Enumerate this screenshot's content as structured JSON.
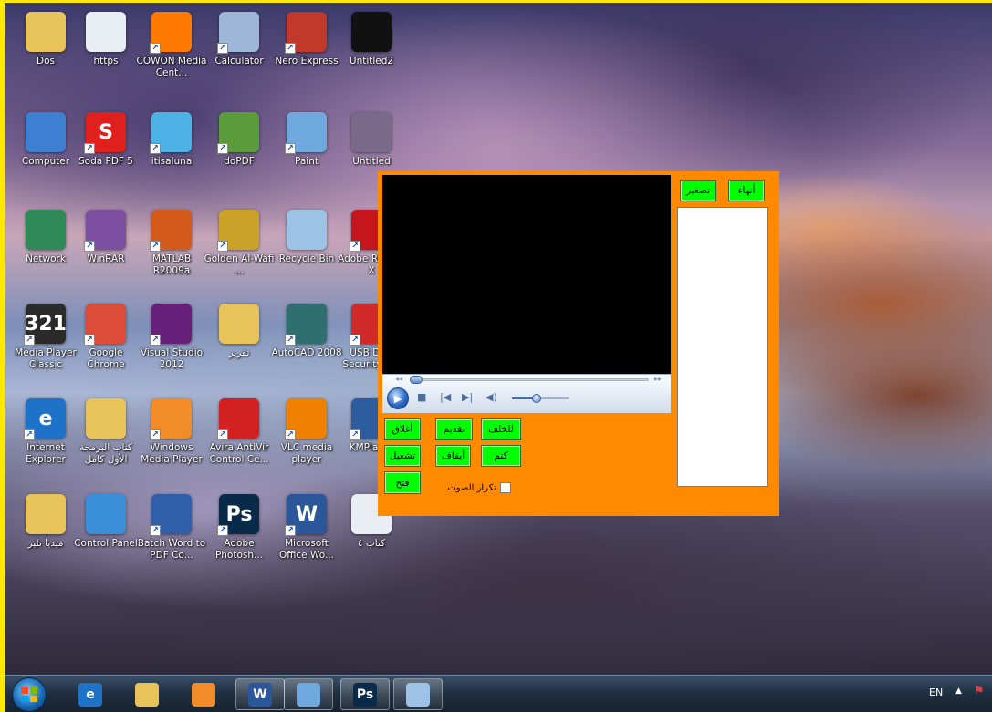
{
  "desktop_icons": [
    {
      "label": "Dos",
      "icon": "folder-user-icon",
      "color": "#e8c35a",
      "glyph": ""
    },
    {
      "label": "https",
      "icon": "document-icon",
      "color": "#e9eef5",
      "glyph": ""
    },
    {
      "label": "COWON Media Cent...",
      "icon": "cowon-icon",
      "color": "#ff7a00",
      "glyph": ""
    },
    {
      "label": "Calculator",
      "icon": "calculator-icon",
      "color": "#9fb7d6",
      "glyph": ""
    },
    {
      "label": "Nero Express",
      "icon": "nero-icon",
      "color": "#c0392b",
      "glyph": ""
    },
    {
      "label": "Untitled2",
      "icon": "image-icon",
      "color": "#111111",
      "glyph": ""
    },
    {
      "label": "Computer",
      "icon": "computer-icon",
      "color": "#3d7fd1",
      "glyph": ""
    },
    {
      "label": "Soda PDF 5",
      "icon": "soda-pdf-icon",
      "color": "#e0201c",
      "glyph": "S"
    },
    {
      "label": "itisaluna",
      "icon": "itisaluna-icon",
      "color": "#4db3e6",
      "glyph": ""
    },
    {
      "label": "doPDF",
      "icon": "dopdf-icon",
      "color": "#5a9b3c",
      "glyph": ""
    },
    {
      "label": "Paint",
      "icon": "paint-icon",
      "color": "#6fa8dc",
      "glyph": ""
    },
    {
      "label": "Untitled",
      "icon": "image-icon",
      "color": "#7a6a8a",
      "glyph": ""
    },
    {
      "label": "Network",
      "icon": "network-icon",
      "color": "#2e8b57",
      "glyph": ""
    },
    {
      "label": "WinRAR",
      "icon": "winrar-icon",
      "color": "#7b4ea0",
      "glyph": ""
    },
    {
      "label": "MATLAB R2009a",
      "icon": "matlab-icon",
      "color": "#d45a1a",
      "glyph": ""
    },
    {
      "label": "Golden Al-Wafi ...",
      "icon": "golden-icon",
      "color": "#c9a227",
      "glyph": ""
    },
    {
      "label": "Recycle Bin",
      "icon": "recycle-bin-icon",
      "color": "#9cc3e6",
      "glyph": ""
    },
    {
      "label": "Adobe Reader X",
      "icon": "adobe-reader-icon",
      "color": "#c4161c",
      "glyph": ""
    },
    {
      "label": "Media Player Classic",
      "icon": "media-player-classic-icon",
      "color": "#2b2b2b",
      "glyph": "321"
    },
    {
      "label": "Google Chrome",
      "icon": "chrome-icon",
      "color": "#dd4b39",
      "glyph": ""
    },
    {
      "label": "Visual Studio 2012",
      "icon": "visual-studio-icon",
      "color": "#68217a",
      "glyph": ""
    },
    {
      "label": "تقرير",
      "icon": "folder-icon",
      "color": "#e8c35a",
      "glyph": ""
    },
    {
      "label": "AutoCAD 2008",
      "icon": "autocad-icon",
      "color": "#2f6f6f",
      "glyph": ""
    },
    {
      "label": "USB Disk Security 5.2",
      "icon": "usb-security-icon",
      "color": "#d12a2a",
      "glyph": ""
    },
    {
      "label": "Internet Explorer",
      "icon": "internet-explorer-icon",
      "color": "#1e73c8",
      "glyph": "e"
    },
    {
      "label": "كتاب البرمجة الأول كامل",
      "icon": "folder-icon",
      "color": "#e8c35a",
      "glyph": ""
    },
    {
      "label": "Windows Media Player",
      "icon": "windows-media-player-icon",
      "color": "#f28c28",
      "glyph": ""
    },
    {
      "label": "Avira AntiVir Control Ce...",
      "icon": "avira-icon",
      "color": "#d32020",
      "glyph": ""
    },
    {
      "label": "VLC media player",
      "icon": "vlc-icon",
      "color": "#f08000",
      "glyph": ""
    },
    {
      "label": "KMPlayer",
      "icon": "kmplayer-icon",
      "color": "#2d5d9f",
      "glyph": ""
    },
    {
      "label": "ميديا بلير",
      "icon": "folder-icon",
      "color": "#e8c35a",
      "glyph": ""
    },
    {
      "label": "Control Panel",
      "icon": "control-panel-icon",
      "color": "#3b8fd8",
      "glyph": ""
    },
    {
      "label": "Batch Word to PDF Co...",
      "icon": "batch-word-pdf-icon",
      "color": "#2f5fa8",
      "glyph": ""
    },
    {
      "label": "Adobe Photosh...",
      "icon": "photoshop-icon",
      "color": "#0a2a4a",
      "glyph": "Ps"
    },
    {
      "label": "Microsoft Office Wo...",
      "icon": "word-icon",
      "color": "#2b579a",
      "glyph": "W"
    },
    {
      "label": "كتاب ٤",
      "icon": "document-icon",
      "color": "#e9eef5",
      "glyph": ""
    }
  ],
  "app_window": {
    "buttons": {
      "exit": "أنهاء",
      "minimize": "تصغير",
      "backward": "للخلف",
      "forward": "تقديم",
      "close": "أغلاق",
      "mute": "كتم",
      "stop": "أيقاف",
      "play": "تشغيل",
      "open": "فتح"
    },
    "repeat_label": "تكرار الصوت",
    "repeat_checked": false,
    "playlist_items": []
  },
  "taskbar": {
    "items": [
      {
        "icon": "internet-explorer-icon",
        "glyph": "e",
        "color": "#1e73c8"
      },
      {
        "icon": "file-explorer-icon",
        "glyph": "",
        "color": "#e8c35a"
      },
      {
        "icon": "windows-media-player-icon",
        "glyph": "",
        "color": "#f28c28"
      },
      {
        "icon": "word-icon",
        "glyph": "W",
        "color": "#2b579a"
      },
      {
        "icon": "paint-icon",
        "glyph": "",
        "color": "#6fa8dc"
      },
      {
        "icon": "photoshop-icon",
        "glyph": "Ps",
        "color": "#0a2a4a"
      },
      {
        "icon": "app-window-icon",
        "glyph": "",
        "color": "#9ec1e8"
      }
    ],
    "language": "EN"
  }
}
